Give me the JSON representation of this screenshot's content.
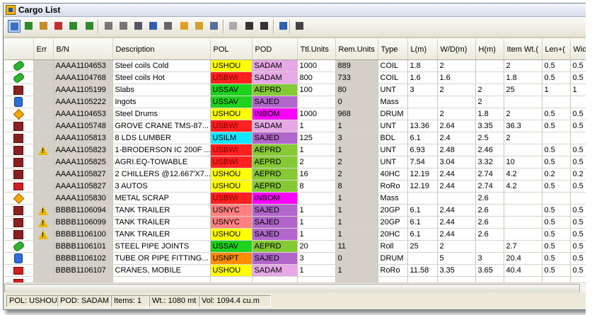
{
  "window": {
    "title": "Cargo List"
  },
  "toolbar": [
    "select-icon",
    "forward-icon",
    "expand-icon",
    "delete-icon",
    "move-icon",
    "export-icon",
    "collapse-icon",
    "indent-icon",
    "sort-icon",
    "sort-az-icon",
    "filter-icon",
    "folder-open-icon",
    "move-folder-icon",
    "copy-icon",
    "filter-disabled-icon",
    "page-icon",
    "pages-icon",
    "columns-icon",
    "print-icon"
  ],
  "columns": [
    "",
    "Err",
    "B/N",
    "Description",
    "POL",
    "POD",
    "Ttl.Units",
    "Rem.Units",
    "Type",
    "L(m)",
    "W/D(m)",
    "H(m)",
    "Item Wt.(",
    "Len+(",
    "Wid"
  ],
  "colors": {
    "USHOU": "#ffff00",
    "USBWI": "#ff2020",
    "USSAV": "#1ed21e",
    "USILM": "#14e6ff",
    "USNYC": "#ff8080",
    "USNPT": "#ff8c00",
    "SADAM": "#e6a8e6",
    "AEPRD": "#85c935",
    "SAJED": "#b266cc",
    "INBOM": "#ff00ff",
    "GRAY": "#d4d0c8"
  },
  "rows": [
    {
      "icon": "green-pipe-icon",
      "err": "",
      "bn": "AAAA1104653",
      "desc": "Steel coils Cold",
      "pol": "USHOU",
      "pod": "SADAM",
      "ttl": "1000",
      "rem": "889",
      "type": "COIL",
      "l": "1.8",
      "w": "2",
      "h": "",
      "wt": "2",
      "len": "0.5",
      "wid": "0.5"
    },
    {
      "icon": "green-pipe-icon",
      "err": "",
      "bn": "AAAA1104768",
      "desc": "Steel coils Hot",
      "pol": "USBWI",
      "pod": "SADAM",
      "ttl": "800",
      "rem": "733",
      "type": "COIL",
      "l": "1.6",
      "w": "1.6",
      "h": "",
      "wt": "1.8",
      "len": "0.5",
      "wid": "0.5"
    },
    {
      "icon": "box-icon",
      "err": "",
      "bn": "AAAA1105199",
      "desc": "Slabs",
      "pol": "USSAV",
      "pod": "AEPRD",
      "ttl": "100",
      "rem": "80",
      "type": "UNT",
      "l": "3",
      "w": "2",
      "h": "2",
      "wt": "25",
      "len": "1",
      "wid": "1"
    },
    {
      "icon": "drum-icon",
      "err": "",
      "bn": "AAAA1105222",
      "desc": "Ingots",
      "pol": "USSAV",
      "pod": "SAJED",
      "ttl": "",
      "rem": "0",
      "type": "Mass",
      "l": "",
      "w": "",
      "h": "2",
      "wt": "",
      "len": "",
      "wid": ""
    },
    {
      "icon": "diamond-icon",
      "err": "",
      "bn": "AAAA1104653",
      "desc": "Steel Drums",
      "pol": "USHOU",
      "pod": "INBOM",
      "ttl": "1000",
      "rem": "968",
      "type": "DRUM",
      "l": "",
      "w": "2",
      "h": "1.8",
      "wt": "2",
      "len": "0.5",
      "wid": "0.5"
    },
    {
      "icon": "box-icon",
      "err": "",
      "bn": "AAAA1105748",
      "desc": "GROVE CRANE TMS-87...",
      "pol": "USBWI",
      "pod": "SADAM",
      "ttl": "1",
      "rem": "1",
      "type": "UNT",
      "l": "13.36",
      "w": "2.64",
      "h": "3.35",
      "wt": "36.3",
      "len": "0.5",
      "wid": "0.5"
    },
    {
      "icon": "box-icon",
      "err": "",
      "bn": "AAAA1105813",
      "desc": "8 LDS LUMBER",
      "pol": "USILM",
      "pod": "SAJED",
      "ttl": "125",
      "rem": "3",
      "type": "BDL",
      "l": "6.1",
      "w": "2.4",
      "h": "2.5",
      "wt": "2",
      "len": "",
      "wid": ""
    },
    {
      "icon": "box-icon",
      "err": "warn",
      "bn": "AAAA1105823",
      "desc": "1-BRODERSON IC 200F ...",
      "pol": "USBWI",
      "pod": "AEPRD",
      "ttl": "1",
      "rem": "1",
      "type": "UNT",
      "l": "6.93",
      "w": "2.48",
      "h": "2.46",
      "wt": "",
      "len": "0.5",
      "wid": "0.5"
    },
    {
      "icon": "box-icon",
      "err": "",
      "bn": "AAAA1105825",
      "desc": "AGRI.EQ-TOWABLE",
      "pol": "USBWI",
      "pod": "AEPRD",
      "ttl": "2",
      "rem": "2",
      "type": "UNT",
      "l": "7.54",
      "w": "3.04",
      "h": "3.32",
      "wt": "10",
      "len": "0.5",
      "wid": "0.5"
    },
    {
      "icon": "box-icon",
      "err": "",
      "bn": "AAAA1105827",
      "desc": "2 CHILLERS @12.667'X7...",
      "pol": "USHOU",
      "pod": "AEPRD",
      "ttl": "16",
      "rem": "2",
      "type": "40HC",
      "l": "12.19",
      "w": "2.44",
      "h": "2.74",
      "wt": "4.2",
      "len": "0.2",
      "wid": "0.2"
    },
    {
      "icon": "truck-icon",
      "err": "",
      "bn": "AAAA1105827",
      "desc": "3 AUTOS",
      "pol": "USHOU",
      "pod": "AEPRD",
      "ttl": "8",
      "rem": "8",
      "type": "RoRo",
      "l": "12.19",
      "w": "2.44",
      "h": "2.74",
      "wt": "4.2",
      "len": "0.5",
      "wid": "0.5"
    },
    {
      "icon": "diamond-icon",
      "err": "",
      "bn": "AAAA1105830",
      "desc": "METAL SCRAP",
      "pol": "USBWI",
      "pod": "INBOM",
      "ttl": "",
      "rem": "1",
      "type": "Mass",
      "l": "",
      "w": "",
      "h": "2.6",
      "wt": "",
      "len": "",
      "wid": ""
    },
    {
      "icon": "box-icon",
      "err": "warn",
      "bn": "BBBB1106094",
      "desc": "TANK TRAILER",
      "pol": "USNYC",
      "pod": "SAJED",
      "ttl": "1",
      "rem": "1",
      "type": "20GP",
      "l": "6.1",
      "w": "2.44",
      "h": "2.6",
      "wt": "",
      "len": "0.5",
      "wid": "0.5"
    },
    {
      "icon": "box-icon",
      "err": "warn",
      "bn": "BBBB1106099",
      "desc": "TANK TRAILER",
      "pol": "USNYC",
      "pod": "SAJED",
      "ttl": "1",
      "rem": "1",
      "type": "20GP",
      "l": "6.1",
      "w": "2.44",
      "h": "2.6",
      "wt": "",
      "len": "0.5",
      "wid": "0.5"
    },
    {
      "icon": "box-icon",
      "err": "warn",
      "bn": "BBBB1106100",
      "desc": "TANK TRAILER",
      "pol": "USHOU",
      "pod": "SAJED",
      "ttl": "1",
      "rem": "1",
      "type": "20HC",
      "l": "6.1",
      "w": "2.44",
      "h": "2.6",
      "wt": "",
      "len": "0.5",
      "wid": "0.5"
    },
    {
      "icon": "green-pipe-icon",
      "err": "",
      "bn": "BBBB1106101",
      "desc": "STEEL PIPE JOINTS",
      "pol": "USSAV",
      "pod": "AEPRD",
      "ttl": "20",
      "rem": "11",
      "type": "Roll",
      "l": "25",
      "w": "2",
      "h": "",
      "wt": "2.7",
      "len": "0.5",
      "wid": "0.5"
    },
    {
      "icon": "drum-icon",
      "err": "",
      "bn": "BBBB1106102",
      "desc": "TUBE OR PIPE FITTING...",
      "pol": "USNPT",
      "pod": "SAJED",
      "ttl": "3",
      "rem": "0",
      "type": "DRUM",
      "l": "",
      "w": "5",
      "h": "3",
      "wt": "20.4",
      "len": "0.5",
      "wid": "0.5"
    },
    {
      "icon": "truck-icon",
      "err": "",
      "bn": "BBBB1106107",
      "desc": "CRANES, MOBILE",
      "pol": "USHOU",
      "pod": "SADAM",
      "ttl": "1",
      "rem": "1",
      "type": "RoRo",
      "l": "11.58",
      "w": "3.35",
      "h": "3.65",
      "wt": "40.4",
      "len": "0.5",
      "wid": "0.5"
    },
    {
      "icon": "truck-icon",
      "err": "",
      "bn": "",
      "desc": "",
      "pol": "",
      "pod": "",
      "ttl": "",
      "rem": "",
      "type": "",
      "l": "",
      "w": "",
      "h": "",
      "wt": "",
      "len": "",
      "wid": ""
    }
  ],
  "status": {
    "pol": "POL: USHOU",
    "pod": "POD: SADAM",
    "items": "Items: 1",
    "wt": "Wt.: 1080 mt",
    "vol": "Vol: 1094.4 cu.m"
  }
}
